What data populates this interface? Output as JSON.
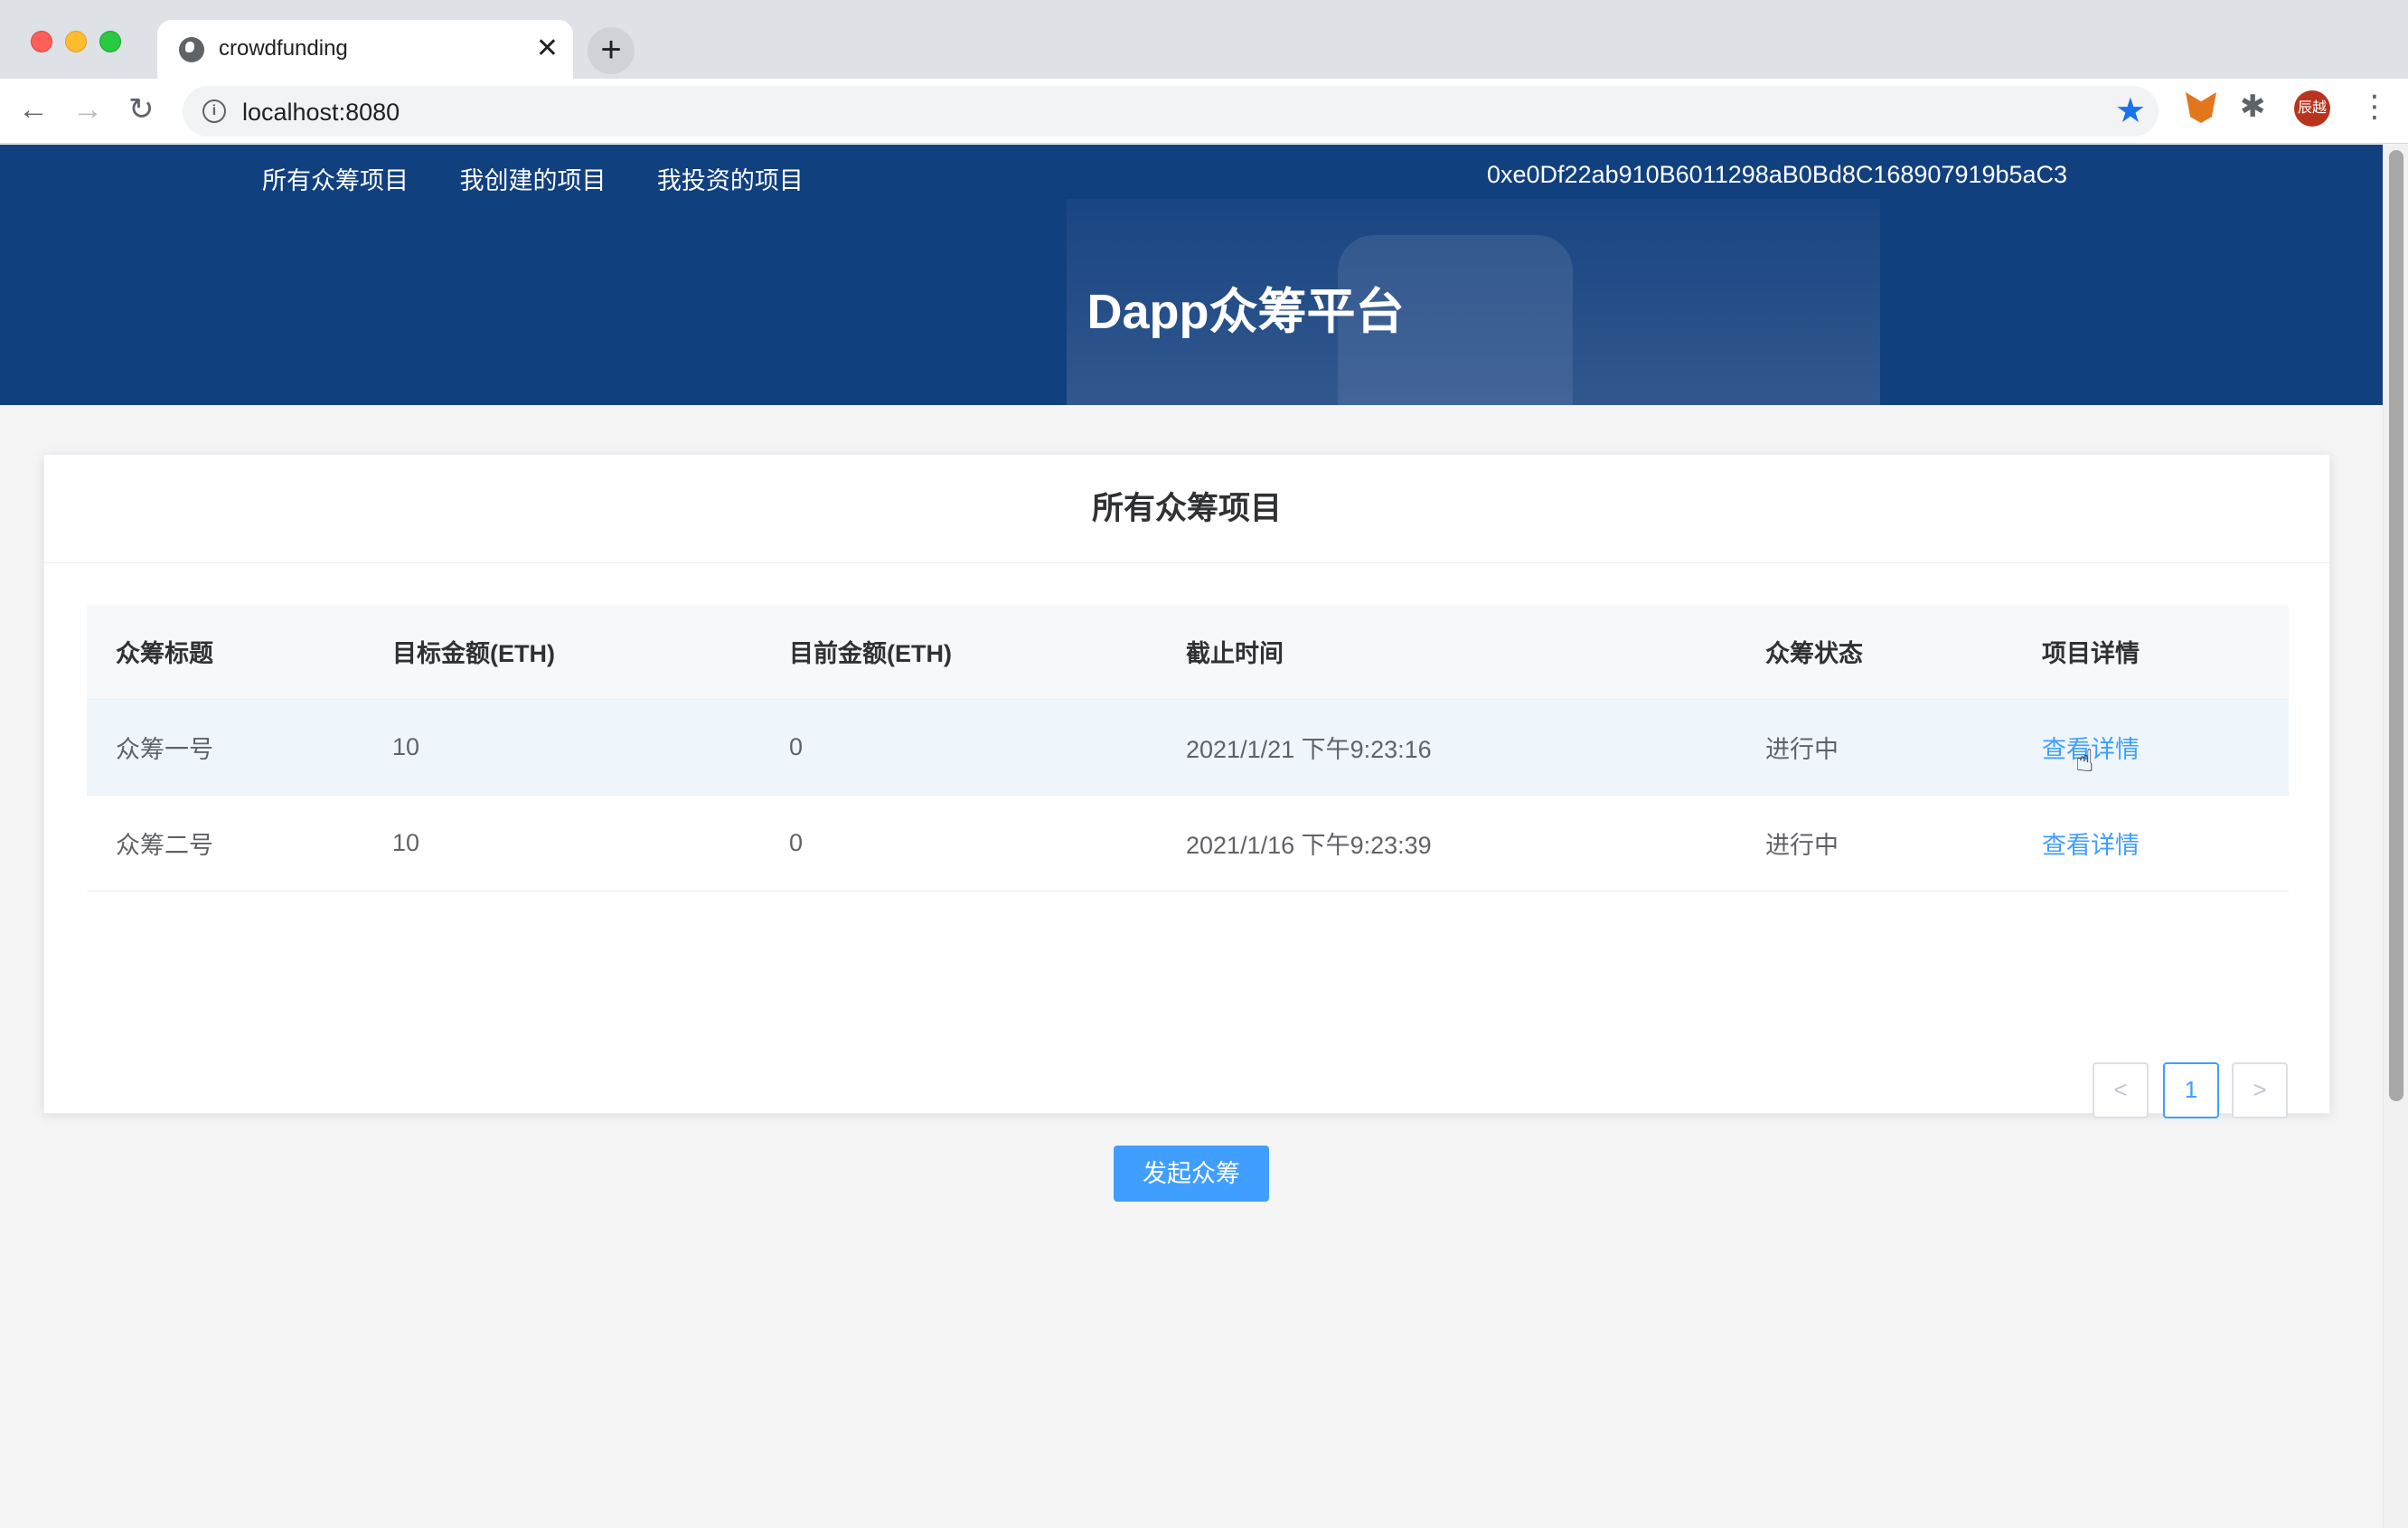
{
  "browser": {
    "tab_title": "crowdfunding",
    "tab_close": "✕",
    "new_tab": "+",
    "url": "localhost:8080",
    "avatar_text": "辰越"
  },
  "nav": {
    "items": [
      "所有众筹项目",
      "我创建的项目",
      "我投资的项目"
    ],
    "account": "0xe0Df22ab910B6011298aB0Bd8C168907919b5aC3"
  },
  "hero": {
    "title": "Dapp众筹平台"
  },
  "card": {
    "title": "所有众筹项目",
    "columns": [
      "众筹标题",
      "目标金额(ETH)",
      "目前金额(ETH)",
      "截止时间",
      "众筹状态",
      "项目详情"
    ],
    "rows": [
      {
        "title": "众筹一号",
        "goal": "10",
        "current": "0",
        "deadline": "2021/1/21 下午9:23:16",
        "status": "进行中",
        "detail": "查看详情"
      },
      {
        "title": "众筹二号",
        "goal": "10",
        "current": "0",
        "deadline": "2021/1/16 下午9:23:39",
        "status": "进行中",
        "detail": "查看详情"
      }
    ],
    "pagination": {
      "prev": "<",
      "page": "1",
      "next": ">"
    },
    "launch_label": "发起众筹"
  },
  "icons": {
    "back": "back-icon",
    "forward": "forward-icon",
    "reload": "reload-icon",
    "star": "bookmark-star-icon",
    "extension": "metamask-icon",
    "puzzle": "extensions-icon",
    "menu": "menu-icon"
  }
}
